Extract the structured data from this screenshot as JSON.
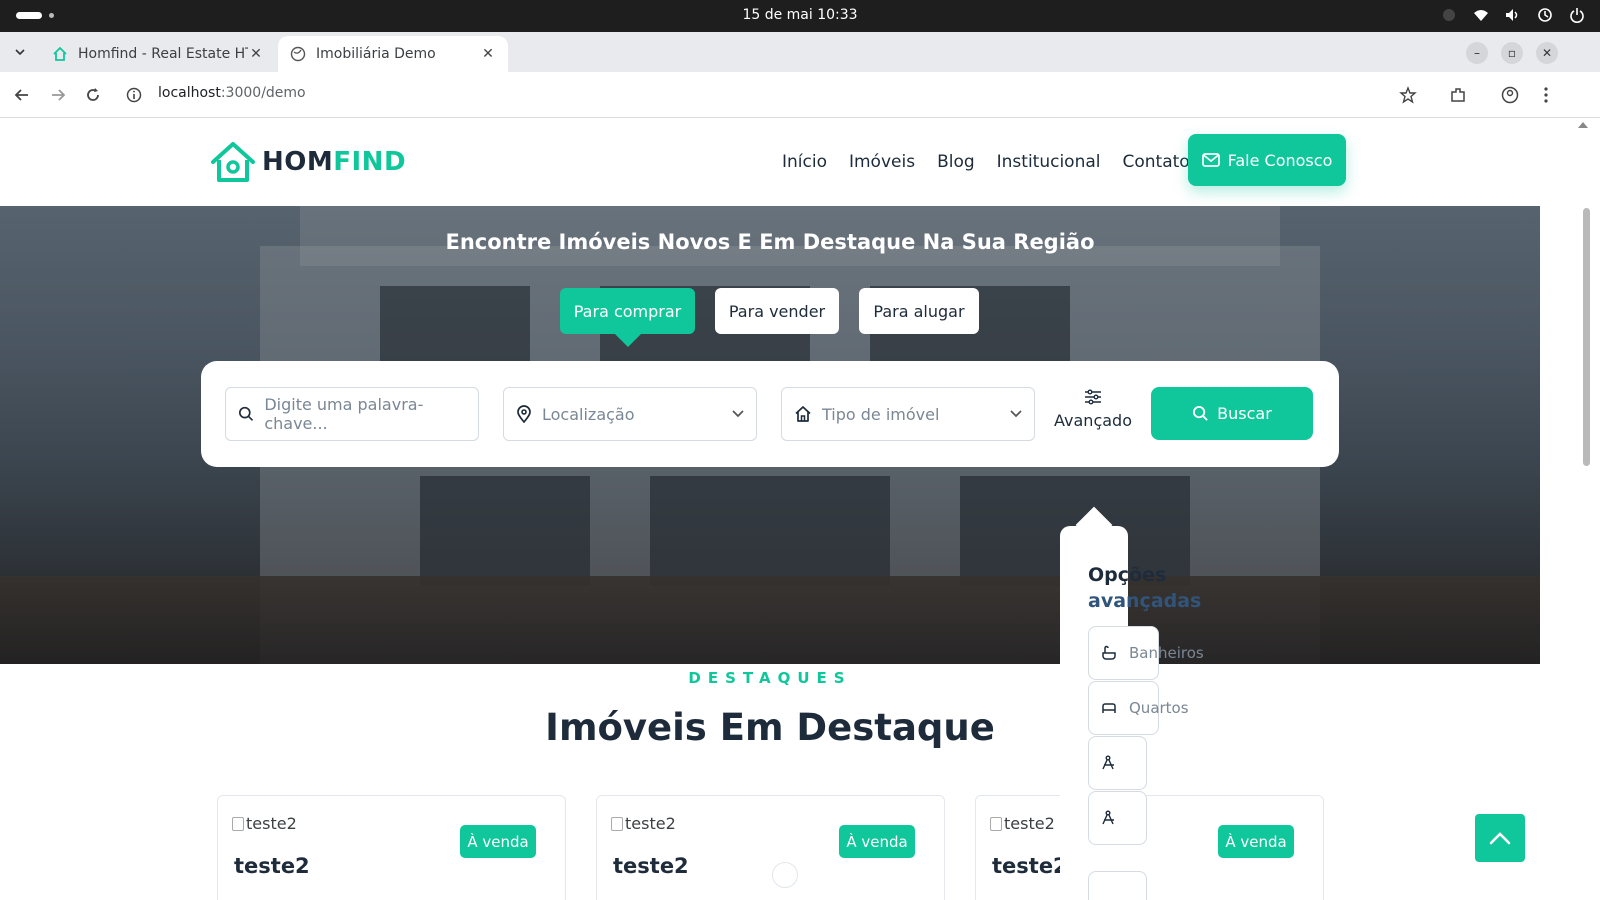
{
  "os": {
    "clock": "15 de mai  10:33"
  },
  "browser": {
    "tabs": [
      {
        "label": "Homfind - Real Estate HT",
        "active": false
      },
      {
        "label": "Imobiliária Demo",
        "active": true
      }
    ],
    "url_host": "localhost",
    "url_path": ":3000/demo"
  },
  "site": {
    "logo_part1": "HOM",
    "logo_part2": "FIND",
    "nav": [
      "Início",
      "Imóveis",
      "Blog",
      "Institucional",
      "Contato"
    ],
    "cta_label": "Fale Conosco"
  },
  "hero": {
    "title": "Encontre Imóveis Novos E Em Destaque Na Sua Região",
    "modes": [
      "Para comprar",
      "Para vender",
      "Para alugar"
    ],
    "active_mode": "Para comprar",
    "search": {
      "keyword_placeholder": "Digite uma palavra-chave...",
      "location_placeholder": "Localização",
      "type_placeholder": "Tipo de imóvel",
      "advanced_label": "Avançado",
      "submit_label": "Buscar"
    }
  },
  "advanced_panel": {
    "heading_line1": "Opções",
    "heading_line2": "avançadas",
    "options": [
      "Banheiros",
      "Quartos",
      "",
      ""
    ]
  },
  "featured": {
    "tag": "DESTAQUES",
    "title": "Imóveis Em Destaque",
    "cards": [
      {
        "image_alt": "teste2",
        "badge": "À venda",
        "title": "teste2"
      },
      {
        "image_alt": "teste2",
        "badge": "À venda",
        "title": "teste2"
      },
      {
        "image_alt": "teste2",
        "badge": "À venda",
        "title": "teste2"
      }
    ]
  },
  "colors": {
    "brand": "#10c79b",
    "dark": "#1d2b3a"
  }
}
